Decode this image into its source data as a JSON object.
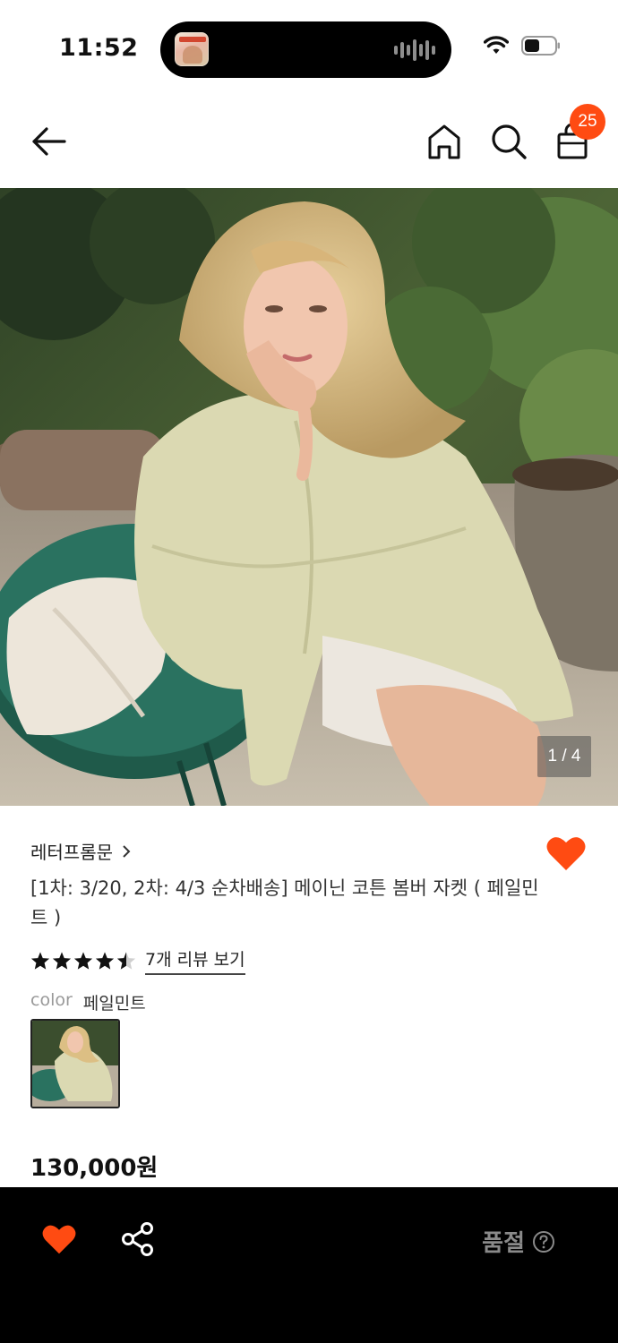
{
  "status_bar": {
    "time": "11:52",
    "icons": [
      "audio-wave-icon",
      "wifi-icon",
      "battery-icon"
    ]
  },
  "nav": {
    "icons": [
      "back-arrow-icon",
      "home-icon",
      "search-icon",
      "shopping-bag-icon"
    ],
    "cart_count": "25"
  },
  "gallery": {
    "counter": "1 / 4"
  },
  "product": {
    "brand": "레터프롬문",
    "title": "[1차: 3/20, 2차: 4/3 순차배송] 메이닌 코튼 봄버 자켓 ( 페일민트 )",
    "rating": 4.5,
    "review_link": "7개 리뷰 보기",
    "color_label": "color",
    "color_value": "페일민트",
    "price": "130,000원",
    "wished": true
  },
  "bottom_bar": {
    "status": "품절",
    "icons": [
      "heart-icon",
      "share-icon",
      "help-circle-icon"
    ]
  },
  "colors": {
    "accent": "#ff4b12",
    "bottom_bg": "#000000"
  }
}
